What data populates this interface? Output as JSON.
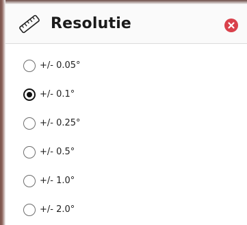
{
  "dialog": {
    "title": "Resolutie",
    "header_icon": "ruler-icon",
    "close_icon": "close-icon",
    "accent_color": "#d9414b"
  },
  "options": [
    {
      "label": "+/- 0.05°",
      "selected": false
    },
    {
      "label": "+/- 0.1°",
      "selected": true
    },
    {
      "label": "+/- 0.25°",
      "selected": false
    },
    {
      "label": "+/- 0.5°",
      "selected": false
    },
    {
      "label": "+/- 1.0°",
      "selected": false
    },
    {
      "label": "+/- 2.0°",
      "selected": false
    }
  ]
}
